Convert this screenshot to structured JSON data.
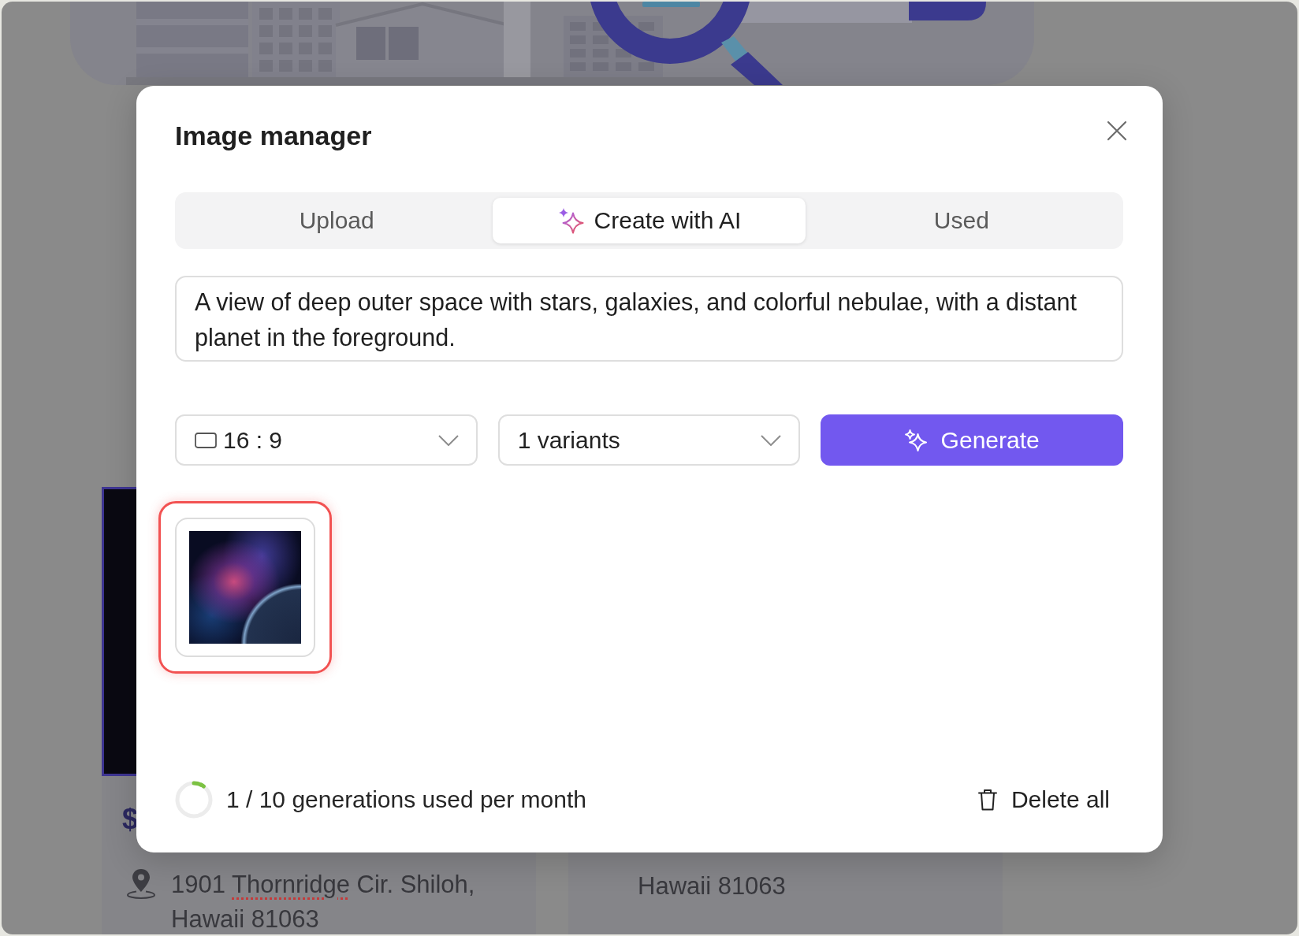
{
  "background": {
    "listings": [
      {
        "has_photo": true,
        "price": "$",
        "has_pin_icon": true,
        "address_lines": [
          {
            "parts": [
              {
                "text": "1901 ",
                "misspelled": false
              },
              {
                "text": "Thornridge",
                "misspelled": true
              },
              {
                "text": " Cir. Shiloh,",
                "misspelled": false
              }
            ]
          },
          {
            "parts": [
              {
                "text": "Hawaii 81063",
                "misspelled": false
              }
            ]
          }
        ]
      },
      {
        "address_lines": [
          {
            "parts": [
              {
                "text": "Hawaii 81063",
                "misspelled": false
              }
            ]
          }
        ]
      }
    ]
  },
  "modal": {
    "title": "Image manager",
    "tabs": [
      {
        "label": "Upload",
        "selected": false,
        "has_icon": false
      },
      {
        "label": "Create with AI",
        "selected": true,
        "has_icon": true
      },
      {
        "label": "Used",
        "selected": false,
        "has_icon": false
      }
    ],
    "prompt": {
      "value": "A view of deep outer space with stars, galaxies, and colorful nebulae, with a distant planet in the foreground."
    },
    "options": [
      {
        "kind": "select",
        "value": "16 : 9",
        "has_icon": true
      },
      {
        "kind": "select",
        "value": "1 variants",
        "has_icon": false
      },
      {
        "kind": "button",
        "label": "Generate"
      }
    ],
    "images": [
      {
        "selected": true
      }
    ],
    "usage": {
      "text": "1 / 10 generations used per month",
      "level": 0.1
    },
    "delete_button": {
      "label": "Delete all"
    }
  }
}
